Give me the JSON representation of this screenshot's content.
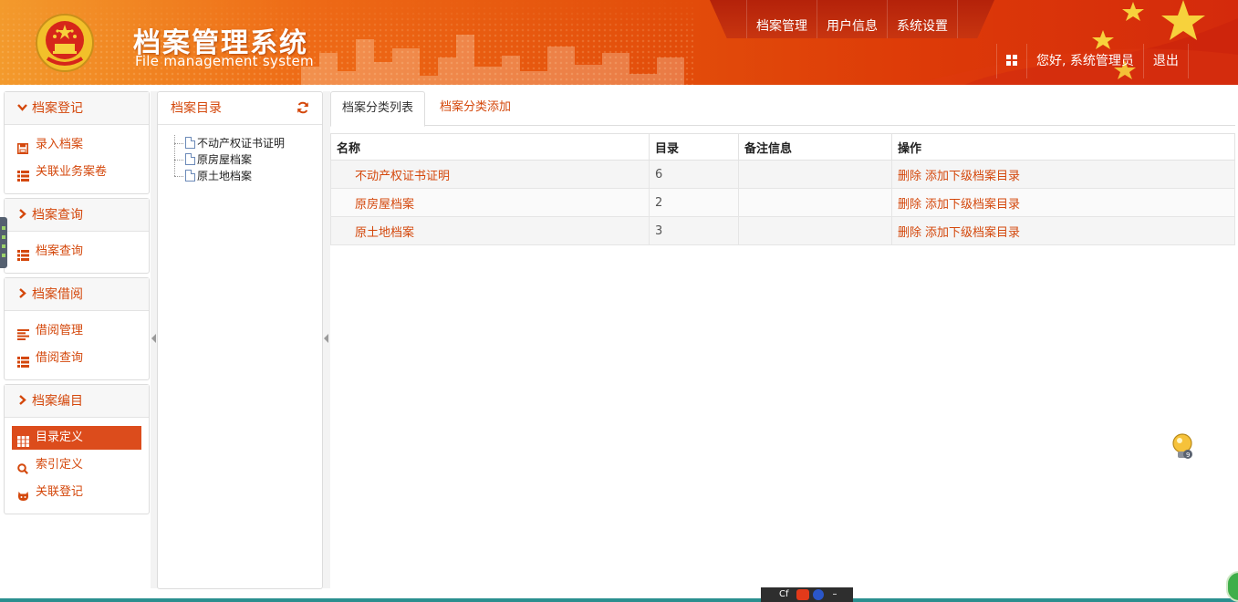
{
  "header": {
    "title": "档案管理系统",
    "subtitle": "File management system",
    "nav": [
      "档案管理",
      "用户信息",
      "系统设置"
    ],
    "greeting": "您好, 系统管理员",
    "logout": "退出"
  },
  "sidebar": {
    "sections": [
      {
        "title": "档案登记",
        "expanded": true,
        "items": [
          {
            "label": "录入档案",
            "icon": "save-icon"
          },
          {
            "label": "关联业务案卷",
            "icon": "list-icon"
          }
        ]
      },
      {
        "title": "档案查询",
        "expanded": false,
        "items": [
          {
            "label": "档案查询",
            "icon": "list-icon"
          }
        ]
      },
      {
        "title": "档案借阅",
        "expanded": false,
        "items": [
          {
            "label": "借阅管理",
            "icon": "align-left-icon"
          },
          {
            "label": "借阅查询",
            "icon": "list-icon"
          }
        ]
      },
      {
        "title": "档案编目",
        "expanded": false,
        "items": [
          {
            "label": "目录定义",
            "icon": "grid-icon",
            "active": true
          },
          {
            "label": "索引定义",
            "icon": "search-icon"
          },
          {
            "label": "关联登记",
            "icon": "github-icon"
          }
        ]
      }
    ]
  },
  "tree": {
    "title": "档案目录",
    "nodes": [
      "不动产权证书证明",
      "原房屋档案",
      "原土地档案"
    ]
  },
  "main": {
    "tabs": [
      {
        "label": "档案分类列表",
        "active": true
      },
      {
        "label": "档案分类添加",
        "active": false
      }
    ],
    "table": {
      "columns": [
        "名称",
        "目录",
        "备注信息",
        "操作"
      ],
      "rows": [
        {
          "name": "不动产权证书证明",
          "dir": "6",
          "note": "",
          "ops": [
            "删除",
            "添加下级档案目录"
          ]
        },
        {
          "name": "原房屋档案",
          "dir": "2",
          "note": "",
          "ops": [
            "删除",
            "添加下级档案目录"
          ]
        },
        {
          "name": "原土地档案",
          "dir": "3",
          "note": "",
          "ops": [
            "删除",
            "添加下级档案目录"
          ]
        }
      ]
    }
  },
  "ime": {
    "label": "Cf"
  },
  "colors": {
    "accent": "#d4480c",
    "active_bg": "#dc4c1c",
    "header_start": "#f39a2c",
    "header_end": "#d42a0c"
  }
}
